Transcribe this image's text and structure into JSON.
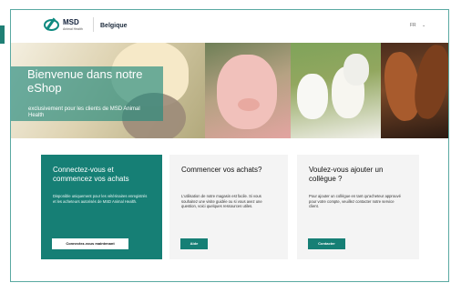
{
  "header": {
    "logo_primary": "MSD",
    "logo_secondary": "Animal Health",
    "country": "Belgique",
    "language": "FR",
    "language_chevron": "⌄"
  },
  "hero": {
    "title": "Bienvenue dans notre eShop",
    "subtitle": "exclusivement pour les clients de MSD Animal Health"
  },
  "cards": [
    {
      "title": "Connectez-vous et commencez vos achats",
      "body": "Disponible uniquement pour les vétérinaires enregistrés et les acheteurs autorisés de MSD Animal Health.",
      "button": "Connectez-vous maintenant"
    },
    {
      "title": "Commencer vos achats?",
      "body": "L'utilisation de notre magasin est facile. Si vous souhaitez une visite guidée ou si vous avez une question, voici quelques ressources utiles.",
      "button": "Aide"
    },
    {
      "title": "Voulez-vous ajouter un collègue ?",
      "body": "Pour ajouter un collègue en tant qu'acheteur approuvé pour votre compte, veuillez contacter notre service client.",
      "button": "Contacter"
    }
  ]
}
